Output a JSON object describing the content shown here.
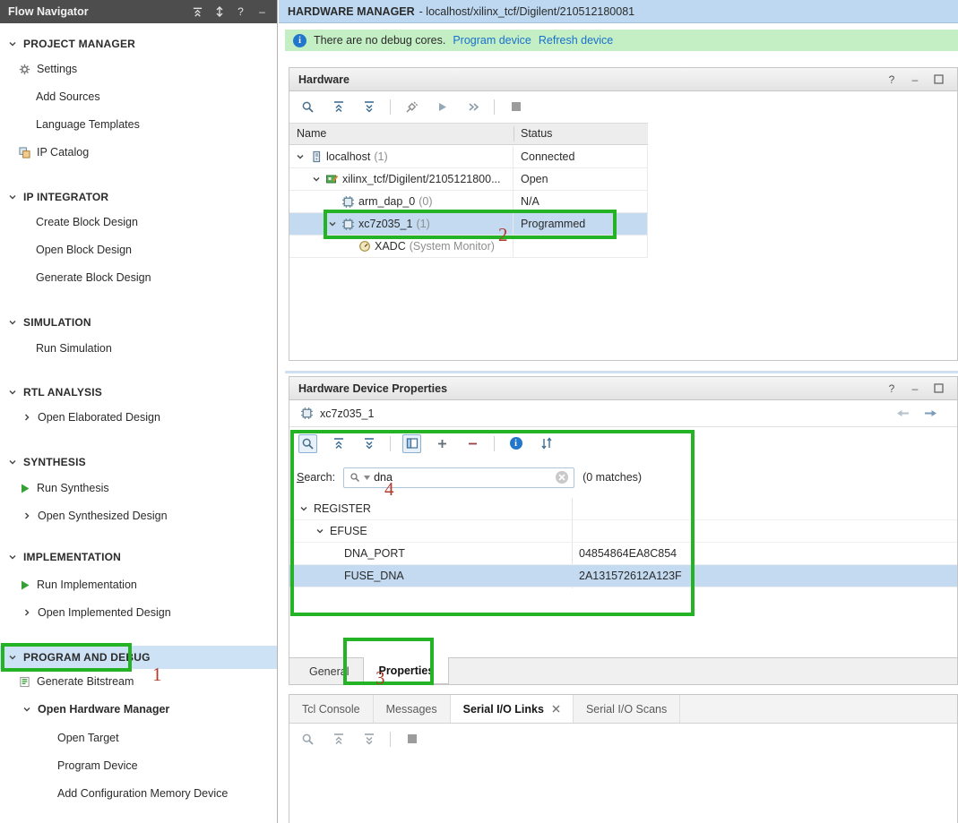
{
  "sidebar": {
    "title": "Flow Navigator",
    "sections": {
      "pm": "PROJECT MANAGER",
      "ipi": "IP INTEGRATOR",
      "sim": "SIMULATION",
      "rtl": "RTL ANALYSIS",
      "syn": "SYNTHESIS",
      "impl": "IMPLEMENTATION",
      "pad": "PROGRAM AND DEBUG"
    },
    "items": {
      "settings": "Settings",
      "add_sources": "Add Sources",
      "language_templates": "Language Templates",
      "ip_catalog": "IP Catalog",
      "create_bd": "Create Block Design",
      "open_bd": "Open Block Design",
      "generate_bd": "Generate Block Design",
      "run_sim": "Run Simulation",
      "open_elab": "Open Elaborated Design",
      "run_synth": "Run Synthesis",
      "open_synth": "Open Synthesized Design",
      "run_impl": "Run Implementation",
      "open_impl": "Open Implemented Design",
      "gen_bitstream": "Generate Bitstream",
      "open_hw_manager": "Open Hardware Manager",
      "open_target": "Open Target",
      "program_device": "Program Device",
      "add_cfg_mem": "Add Configuration Memory Device"
    }
  },
  "titlebar": {
    "app": "HARDWARE MANAGER",
    "context": "- localhost/xilinx_tcf/Digilent/210512180081"
  },
  "infobar": {
    "message": "There are no debug cores.",
    "program_link": "Program device",
    "refresh_link": "Refresh device"
  },
  "hardware": {
    "title": "Hardware",
    "columns": {
      "name": "Name",
      "status": "Status"
    },
    "rows": [
      {
        "name": "localhost",
        "note": "(1)",
        "status": "Connected"
      },
      {
        "name": "xilinx_tcf/Digilent/2105121800...",
        "note": "",
        "status": "Open"
      },
      {
        "name": "arm_dap_0",
        "note": "(0)",
        "status": "N/A"
      },
      {
        "name": "xc7z035_1",
        "note": "(1)",
        "status": "Programmed"
      },
      {
        "name": "XADC",
        "note": "(System Monitor)",
        "status": ""
      }
    ]
  },
  "device_props": {
    "title": "Hardware Device Properties",
    "device": "xc7z035_1",
    "search_label": "Search:",
    "search_value": "dna",
    "matches": "(0 matches)",
    "tree": {
      "register": "REGISTER",
      "efuse": "EFUSE",
      "rows": [
        {
          "name": "DNA_PORT",
          "value": "04854864EA8C854"
        },
        {
          "name": "FUSE_DNA",
          "value": "2A131572612A123F"
        }
      ]
    },
    "tabs": {
      "general": "General",
      "properties": "Properties"
    }
  },
  "console": {
    "tabs": {
      "tcl": "Tcl Console",
      "messages": "Messages",
      "links": "Serial I/O Links",
      "scans": "Serial I/O Scans"
    }
  },
  "controls": {
    "help": "?",
    "min": "–"
  },
  "annotations": {
    "n1": "1",
    "n2": "2",
    "n3": "3",
    "n4": "4"
  }
}
